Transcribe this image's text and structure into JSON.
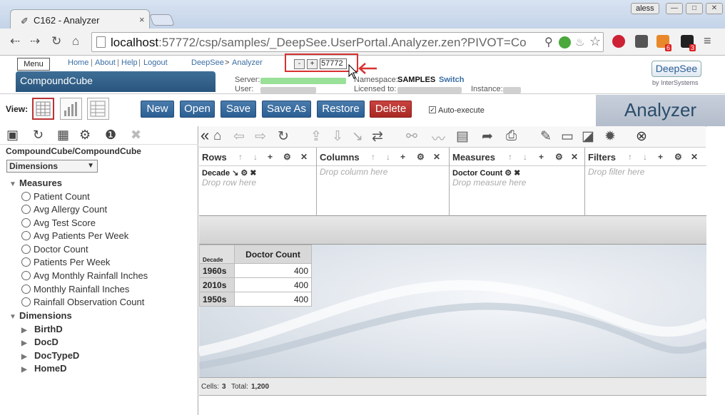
{
  "browser": {
    "tab_title": "C162 - Analyzer",
    "tab_close": "×",
    "user_name": "aless",
    "url_host": "localhost",
    "url_rest": ":57772/csp/samples/_DeepSee.UserPortal.Analyzer.zen?PIVOT=Co",
    "badge_feed": "6",
    "badge_ext": "3"
  },
  "header": {
    "menu_label": "Menu",
    "links": [
      "Home",
      "About",
      "Help",
      "Logout"
    ],
    "separators": [
      "|",
      "|",
      "|"
    ],
    "breadcrumb_root": "DeepSee",
    "breadcrumb_sep": ">",
    "breadcrumb_page": "Analyzer",
    "cube_title": "CompoundCube",
    "server_label": "Server:",
    "user_label": "User:",
    "namespace_label": "Namespace:",
    "namespace_value": "SAMPLES",
    "switch_link": "Switch",
    "licensed_label": "Licensed to:",
    "instance_label": "Instance:",
    "brand": "DeepSee",
    "brand_sub": "by InterSystems",
    "analyzer_title": "Analyzer"
  },
  "zoomer": {
    "minus": "-",
    "plus": "+",
    "value": "57772"
  },
  "toolbar": {
    "view_label": "View:",
    "buttons": [
      "New",
      "Open",
      "Save",
      "Save As",
      "Restore",
      "Delete"
    ],
    "auto_execute_label": "Auto-execute",
    "auto_execute_checked": true
  },
  "left_panel": {
    "cube_path": "CompoundCube/CompoundCube",
    "selector_value": "Dimensions",
    "measures_label": "Measures",
    "measures": [
      "Patient Count",
      "Avg Allergy Count",
      "Avg Test Score",
      "Avg Patients Per Week",
      "Doctor Count",
      "Patients Per Week",
      "Avg Monthly Rainfall Inches",
      "Monthly Rainfall Inches",
      "Rainfall Observation Count"
    ],
    "dimensions_label": "Dimensions",
    "dimensions": [
      "BirthD",
      "DocD",
      "DocTypeD",
      "HomeD"
    ]
  },
  "shelves": {
    "rows_title": "Rows",
    "rows_item": "Decade",
    "rows_drop": "Drop row here",
    "columns_title": "Columns",
    "columns_drop": "Drop column here",
    "measures_title": "Measures",
    "measures_item": "Doctor Count",
    "measures_drop": "Drop measure here",
    "filters_title": "Filters",
    "filters_drop": "Drop filter here"
  },
  "pivot": {
    "corner_label": "Decade",
    "column_header": "Doctor Count",
    "rows": [
      {
        "label": "1960s",
        "value": "400"
      },
      {
        "label": "2010s",
        "value": "400"
      },
      {
        "label": "1950s",
        "value": "400"
      }
    ]
  },
  "status": {
    "cells_label": "Cells:",
    "cells_value": "3",
    "total_label": "Total:",
    "total_value": "1,200"
  },
  "colors": {
    "accent": "#2b5f93",
    "delete": "#b8322f",
    "highlight": "#d93030"
  }
}
